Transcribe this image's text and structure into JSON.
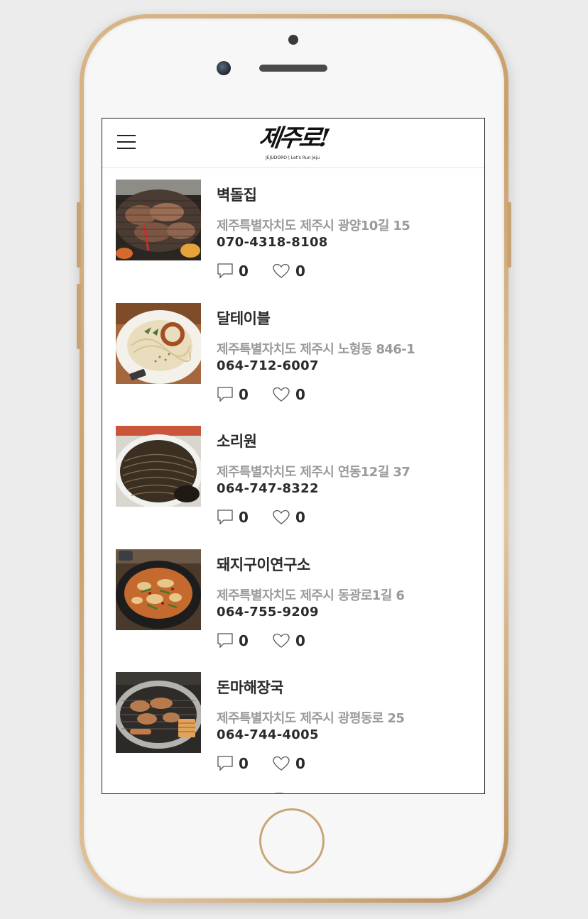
{
  "app": {
    "logo_text": "제주로!",
    "logo_subtitle": "JEJUDORO | Let's Run Jeju",
    "menu_icon": "hamburger-menu-icon"
  },
  "restaurants": [
    {
      "name": "벽돌집",
      "address": "제주특별자치도 제주시 광양10길 15",
      "phone": "070-4318-8108",
      "comments": "0",
      "likes": "0",
      "photo": "grilled-pork-on-grill"
    },
    {
      "name": "달테이블",
      "address": "제주특별자치도 제주시 노형동 846-1",
      "phone": "064-712-6007",
      "comments": "0",
      "likes": "0",
      "photo": "cream-pasta-with-sausage"
    },
    {
      "name": "소리원",
      "address": "제주특별자치도 제주시 연동12길 37",
      "phone": "064-747-8322",
      "comments": "0",
      "likes": "0",
      "photo": "black-bean-noodles"
    },
    {
      "name": "돼지구이연구소",
      "address": "제주특별자치도 제주시 동광로1길 6",
      "phone": "064-755-9209",
      "comments": "0",
      "likes": "0",
      "photo": "stir-fried-spicy-pork"
    },
    {
      "name": "돈마해장국",
      "address": "제주특별자치도 제주시 광평동로 25",
      "phone": "064-744-4005",
      "comments": "0",
      "likes": "0",
      "photo": "grilled-pork-on-charcoal"
    }
  ],
  "icons": {
    "comment": "comment-bubble-icon",
    "like": "heart-icon"
  },
  "colors": {
    "background": "#ececec",
    "phone_frame": "#c9a06a",
    "title_text": "#2a2a2a",
    "address_text": "#9a9a9a"
  }
}
